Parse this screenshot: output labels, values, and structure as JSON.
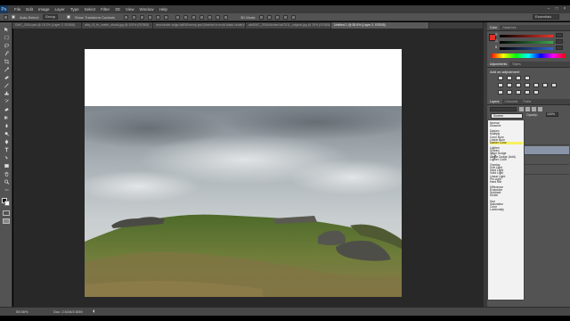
{
  "app": {
    "logo": "Ps"
  },
  "menu": [
    "File",
    "Edit",
    "Image",
    "Layer",
    "Type",
    "Select",
    "Filter",
    "3D",
    "View",
    "Window",
    "Help"
  ],
  "window_controls": [
    "–",
    "□",
    "×"
  ],
  "options_bar": {
    "auto_select_label": "Auto-Select:",
    "auto_select_value": "Group",
    "show_transform_label": "Show Transform Controls",
    "mode_3d_label": "3D Mode:",
    "workspace": "Essentials"
  },
  "tabs": [
    {
      "label": "DMC_2934.psd @ 15.2% (Layer 2, RGB/8)",
      "active": false
    },
    {
      "label": "alby_t3_fe_castle_shock.jpg @ 100% (RGB/8)",
      "active": false
    },
    {
      "label": "rem/cinder-edge-fall/06/nemp.psd (blanket in mold black cinder)/DMC_2934/divider/uk.psd",
      "active": false
    },
    {
      "label": "aleDMC_2934/divider/uk/7011_original.jpg @ 25% (RGB/8)",
      "active": false
    },
    {
      "label": "Untitled-1 @ 55.6% (Layer 2, RGB/8)",
      "active": true
    }
  ],
  "status_bar": {
    "zoom": "55.56%",
    "doc_size": "Doc: 2.61M/2.60M"
  },
  "color_panel": {
    "tabs": [
      "Color",
      "Swatches"
    ],
    "channels": [
      "R",
      "G",
      "B"
    ],
    "channel_colors": [
      "#e8342a",
      "#3aa64b",
      "#3066c8"
    ]
  },
  "adjustments_panel": {
    "tabs": [
      "Adjustments",
      "Styles"
    ],
    "prompt": "Add an adjustment"
  },
  "layers_panel": {
    "tabs": [
      "Layers",
      "Channels",
      "Paths"
    ],
    "blend_mode": "Screen",
    "opacity_label": "Opacity:",
    "opacity_value": "100%"
  },
  "blend_modes": [
    {
      "label": "Normal"
    },
    {
      "label": "Dissolve"
    },
    {
      "sep": true
    },
    {
      "label": "Darken"
    },
    {
      "label": "Multiply"
    },
    {
      "label": "Color Burn"
    },
    {
      "label": "Linear Burn"
    },
    {
      "label": "Darker Color",
      "highlight": true
    },
    {
      "sep": true
    },
    {
      "label": "Lighten"
    },
    {
      "label": "Screen"
    },
    {
      "label": "Color Dodge"
    },
    {
      "label": "Linear Dodge (Add)"
    },
    {
      "label": "Lighter Color"
    },
    {
      "sep": true
    },
    {
      "label": "Overlay"
    },
    {
      "label": "Soft Light"
    },
    {
      "label": "Hard Light"
    },
    {
      "label": "Vivid Light"
    },
    {
      "label": "Linear Light"
    },
    {
      "label": "Pin Light"
    },
    {
      "label": "Hard Mix"
    },
    {
      "sep": true
    },
    {
      "label": "Difference"
    },
    {
      "label": "Exclusion"
    },
    {
      "label": "Subtract"
    },
    {
      "label": "Divide"
    },
    {
      "sep": true
    },
    {
      "label": "Hue"
    },
    {
      "label": "Saturation"
    },
    {
      "label": "Color"
    },
    {
      "label": "Luminosity"
    }
  ],
  "tools": [
    "move-tool",
    "marquee-tool",
    "lasso-tool",
    "quick-select-tool",
    "crop-tool",
    "eyedropper-tool",
    "healing-brush-tool",
    "brush-tool",
    "clone-stamp-tool",
    "history-brush-tool",
    "eraser-tool",
    "gradient-tool",
    "blur-tool",
    "dodge-tool",
    "pen-tool",
    "type-tool",
    "path-select-tool",
    "rectangle-tool",
    "hand-tool",
    "zoom-tool"
  ]
}
